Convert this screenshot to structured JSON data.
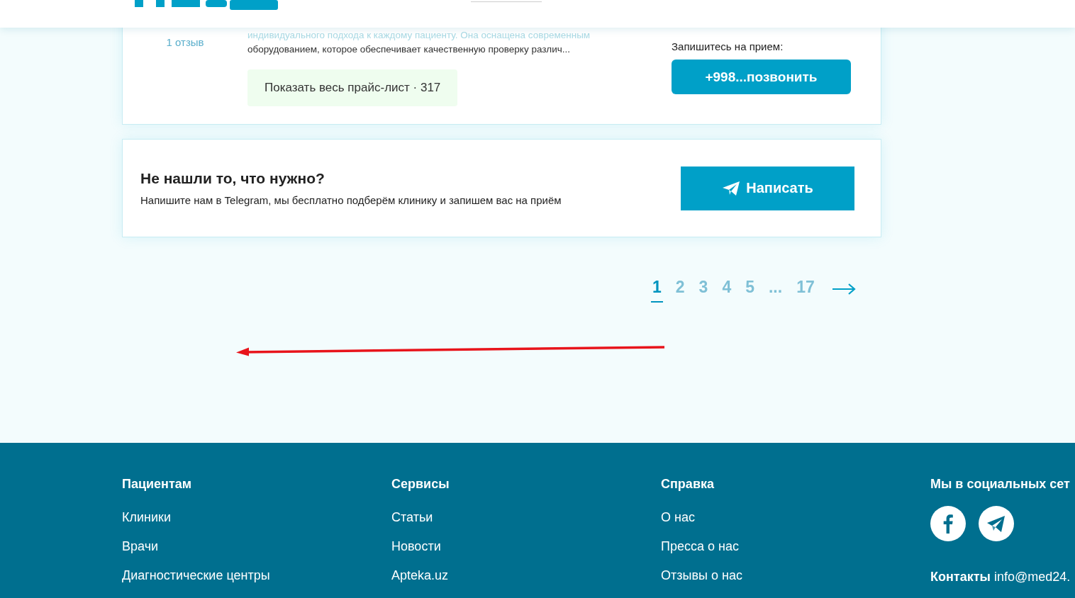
{
  "review_card": {
    "reviews": "1 отзыв",
    "description": [
      {
        "text": "индивидуального подхода к каждому пациенту. Она оснащена современным",
        "faded": true
      },
      {
        "text": "оборудованием, которое обеспечивает качественную проверку различ...",
        "faded": false
      }
    ],
    "price_button": "Показать весь прайс-лист · 317",
    "booking_label": "Запишитесь на прием:",
    "call_button": "+998...позвонить"
  },
  "help_card": {
    "title": "Не нашли то, что нужно?",
    "text": "Напишите нам в Telegram, мы бесплатно подберём клинику и запишем вас на приём",
    "button": "Написать"
  },
  "pagination": {
    "pages": [
      {
        "label": "1",
        "selected": true
      },
      {
        "label": "2",
        "selected": false
      },
      {
        "label": "3",
        "selected": false
      },
      {
        "label": "4",
        "selected": false
      },
      {
        "label": "5",
        "selected": false
      },
      {
        "label": "...",
        "selected": false
      },
      {
        "label": "17",
        "selected": false
      }
    ]
  },
  "footer": {
    "columns": [
      {
        "title": "Пациентам",
        "kind": "links",
        "links": [
          "Клиники",
          "Врачи",
          "Диагностические центры"
        ]
      },
      {
        "title": "Сервисы",
        "kind": "links",
        "links": [
          "Статьи",
          "Новости",
          "Apteka.uz"
        ]
      },
      {
        "title": "Справка",
        "kind": "links",
        "links": [
          "О нас",
          "Пресса о нас",
          "Отзывы о нас"
        ]
      },
      {
        "title": "Мы в социальных сет",
        "kind": "social",
        "contacts_label": "Контакты",
        "contacts_value": "info@med24."
      }
    ]
  }
}
